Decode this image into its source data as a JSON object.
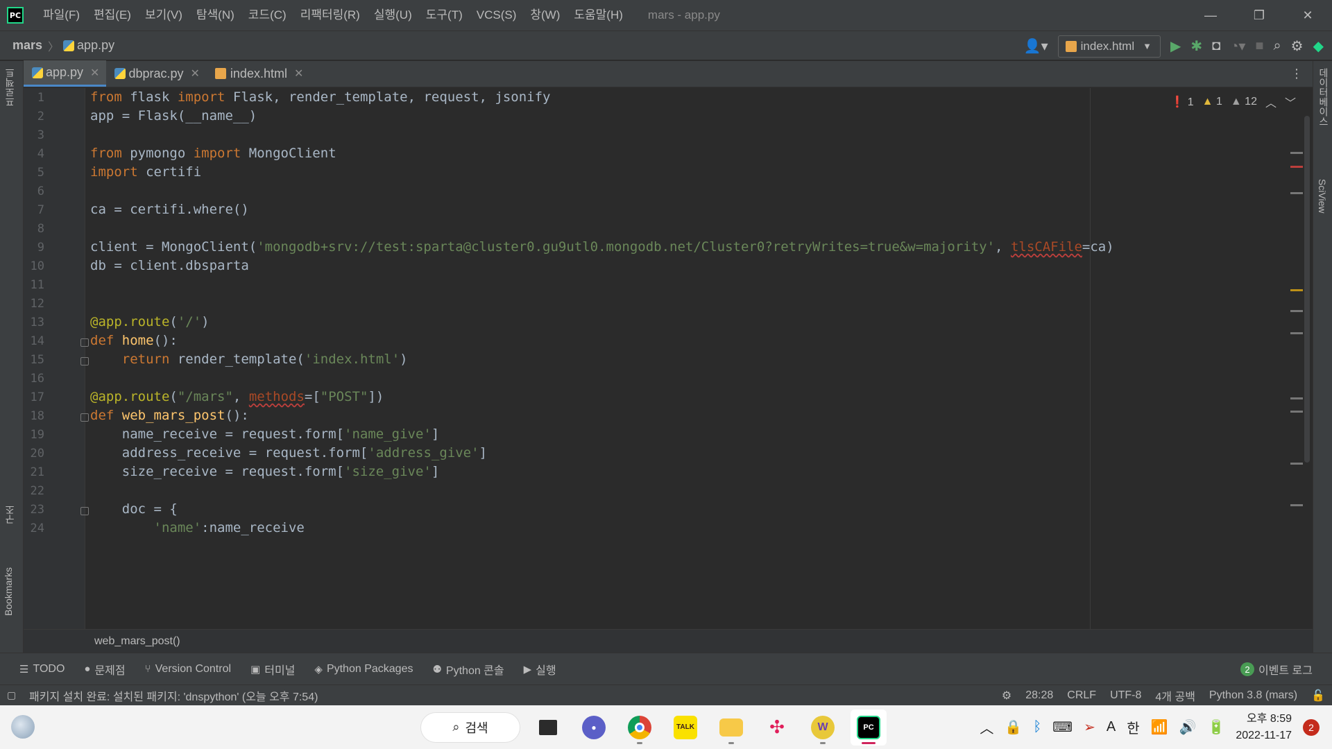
{
  "titlebar": {
    "menu": [
      "파일(F)",
      "편집(E)",
      "보기(V)",
      "탐색(N)",
      "코드(C)",
      "리팩터링(R)",
      "실행(U)",
      "도구(T)",
      "VCS(S)",
      "창(W)",
      "도움말(H)"
    ],
    "window_title": "mars - app.py",
    "minimize": "—",
    "restore": "❐",
    "close": "✕"
  },
  "navbar": {
    "project": "mars",
    "file": "app.py",
    "run_config": "index.html"
  },
  "left_strip": {
    "project": "프로젝트",
    "structure": "구조",
    "bookmarks": "Bookmarks"
  },
  "right_strip": {
    "database": "데이터베이스",
    "sciview": "SciView"
  },
  "tabs": [
    {
      "label": "app.py",
      "icon": "python-file-icon",
      "active": true
    },
    {
      "label": "dbprac.py",
      "icon": "python-file-icon",
      "active": false
    },
    {
      "label": "index.html",
      "icon": "html-file-icon",
      "active": false
    }
  ],
  "inspections": {
    "errors": "1",
    "warnings": "1",
    "weak_warnings": "12"
  },
  "editor": {
    "line_numbers": [
      "1",
      "2",
      "3",
      "4",
      "5",
      "6",
      "7",
      "8",
      "9",
      "10",
      "11",
      "12",
      "13",
      "14",
      "15",
      "16",
      "17",
      "18",
      "19",
      "20",
      "21",
      "22",
      "23",
      "24"
    ],
    "lines": [
      "from flask import Flask, render_template, request, jsonify",
      "app = Flask(__name__)",
      "",
      "from pymongo import MongoClient",
      "import certifi",
      "",
      "ca = certifi.where()",
      "",
      "client = MongoClient('mongodb+srv://test:sparta@cluster0.gu9utl0.mongodb.net/Cluster0?retryWrites=true&w=majority', tlsCAFile=ca)",
      "db = client.dbsparta",
      "",
      "",
      "@app.route('/')",
      "def home():",
      "    return render_template('index.html')",
      "",
      "@app.route(\"/mars\", methods=[\"POST\"])",
      "def web_mars_post():",
      "    name_receive = request.form['name_give']",
      "    address_receive = request.form['address_give']",
      "    size_receive = request.form['size_give']",
      "",
      "    doc = {",
      "        'name':name_receive"
    ]
  },
  "editor_breadcrumb": "web_mars_post()",
  "tool_windows": [
    "TODO",
    "문제점",
    "Version Control",
    "터미널",
    "Python Packages",
    "Python 콘솔",
    "실행"
  ],
  "event_log": {
    "count": "2",
    "label": "이벤트 로그"
  },
  "statusbar": {
    "message": "패키지 설치 완료: 설치된 패키지: 'dnspython' (오늘 오후 7:54)",
    "position": "28:28",
    "line_sep": "CRLF",
    "encoding": "UTF-8",
    "indent": "4개 공백",
    "interpreter": "Python 3.8 (mars)"
  },
  "taskbar": {
    "search": "검색",
    "ime_lang": "한",
    "ime_mode": "A",
    "time": "오후 8:59",
    "date": "2022-11-17",
    "notifications": "2"
  }
}
